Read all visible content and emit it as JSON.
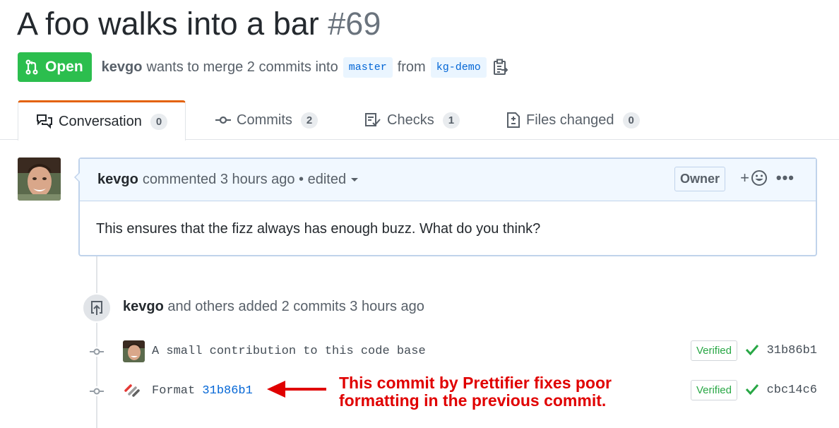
{
  "pr": {
    "title": "A foo walks into a bar",
    "number": "#69",
    "state": "Open",
    "author": "kevgo",
    "merge_text": "wants to merge 2 commits into",
    "base_branch": "master",
    "from_text": "from",
    "head_branch": "kg-demo"
  },
  "tabs": [
    {
      "label": "Conversation",
      "count": "0",
      "icon": "comment-discussion-icon",
      "selected": true
    },
    {
      "label": "Commits",
      "count": "2",
      "icon": "git-commit-icon"
    },
    {
      "label": "Checks",
      "count": "1",
      "icon": "checklist-icon"
    },
    {
      "label": "Files changed",
      "count": "0",
      "icon": "file-diff-icon"
    }
  ],
  "comment": {
    "author": "kevgo",
    "action": "commented 3 hours ago • edited",
    "role": "Owner",
    "reaction_label": "+",
    "more_label": "•••",
    "body": "This ensures that the fizz always has enough buzz. What do you think?"
  },
  "push_event": {
    "author": "kevgo",
    "text": "and others added 2 commits 3 hours ago"
  },
  "commits": [
    {
      "message": "A small contribution to this code base",
      "verified": "Verified",
      "sha": "31b86b1",
      "avatar": "user-avatar"
    },
    {
      "message": "Format",
      "message_link": "31b86b1",
      "verified": "Verified",
      "sha": "cbc14c6",
      "avatar": "prettifier-logo"
    }
  ],
  "annotation": {
    "line1": "This commit by Prettifier fixes poor",
    "line2": "formatting in the previous commit.",
    "color": "#e00000"
  },
  "colors": {
    "open_green": "#2cbe4e",
    "tab_accent": "#e36209",
    "link_blue": "#0366d6",
    "verified_green": "#28a745",
    "comment_header_bg": "#f1f8ff"
  }
}
